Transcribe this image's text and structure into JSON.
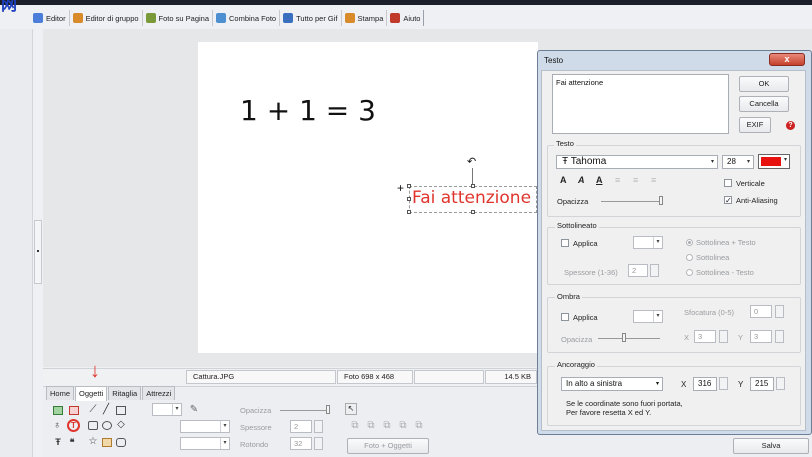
{
  "app": {
    "logo_glyph": "网",
    "tabs": [
      {
        "label": "Editor",
        "icon": "editor-icon",
        "color": "#4a7ed8"
      },
      {
        "label": "Editor di gruppo",
        "icon": "batch-editor-icon",
        "color": "#d98a2b"
      },
      {
        "label": "Foto su Pagina",
        "icon": "photo-page-icon",
        "color": "#7a9a3a"
      },
      {
        "label": "Combina Foto",
        "icon": "combine-icon",
        "color": "#4d8fd0"
      },
      {
        "label": "Tutto per Gif",
        "icon": "gif-icon",
        "color": "#3a6fbf"
      },
      {
        "label": "Stampa",
        "icon": "print-icon",
        "color": "#d98a2b"
      },
      {
        "label": "Aiuto",
        "icon": "help-icon",
        "color": "#c0392b"
      }
    ]
  },
  "canvas": {
    "main_text": "1 + 1 = 3",
    "selected_text": "Fai attenzione",
    "selected_text_color": "#e0342c"
  },
  "status": {
    "filename": "Cattura.JPG",
    "photo_size": "Foto 698 x 468",
    "file_size": "14.5 KB"
  },
  "bottom": {
    "tabs": [
      "Home",
      "Oggetti",
      "Ritaglia",
      "Attrezzi"
    ],
    "active_tab": "Oggetti",
    "opacity_label": "Opacizza",
    "thickness_label": "Spessore",
    "thickness_value": "2",
    "rounded_label": "Rotondo",
    "rounded_value": "32",
    "photo_objects_button": "Foto + Oggetti",
    "save_button": "Salva"
  },
  "dialog": {
    "title": "Testo",
    "close_glyph": "x",
    "text_value": "Fai attenzione",
    "ok": "OK",
    "cancel": "Cancella",
    "exif": "EXIF",
    "help_glyph": "?",
    "text_section": "Testo",
    "font_glyph": "Ŧ",
    "font_name": "Tahoma",
    "font_size": "28",
    "color": "#e8130e",
    "bold_glyph": "A",
    "italic_glyph": "A",
    "underline_glyph": "A",
    "align_glyphs": [
      "≡",
      "≡",
      "≡"
    ],
    "vertical": "Verticale",
    "antialias": "Anti-Aliasing",
    "opacity": "Opacizza",
    "underline_section": "Sottolineato",
    "apply": "Applica",
    "thickness": "Spessore (1-36)",
    "thickness_value": "2",
    "underline_opts": [
      "Sottolinea + Testo",
      "Sottolinea",
      "Sottolinea - Testo"
    ],
    "shadow_section": "Ombra",
    "shadow_apply": "Applica",
    "blur": "Sfocatura (0-5)",
    "blur_value": "0",
    "shadow_opacity": "Opacizza",
    "shadow_x_label": "X",
    "shadow_x": "3",
    "shadow_y_label": "Y",
    "shadow_y": "3",
    "anchor_section": "Ancoraggio",
    "anchor_value": "In alto a sinistra",
    "anchor_x_label": "X",
    "anchor_x": "316",
    "anchor_y_label": "Y",
    "anchor_y": "215",
    "note_line1": "Se le coordinate sono fuori portata,",
    "note_line2": "Per favore resetta X ed Y."
  },
  "glyphs": {
    "arrow_down": "↓",
    "rotate": "↶",
    "plus": "+",
    "dropdown": "▾",
    "spin_up": "▲",
    "spin_down": "▼"
  }
}
